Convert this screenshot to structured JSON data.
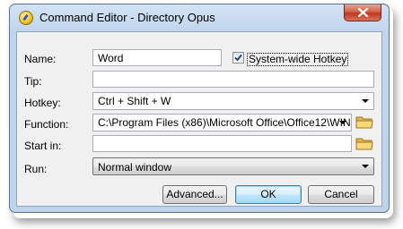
{
  "window": {
    "title": "Command Editor - Directory Opus"
  },
  "form": {
    "name_label": "Name:",
    "name_value": "Word",
    "system_hotkey_label": "System-wide Hotkey",
    "system_hotkey_checked": true,
    "tip_label": "Tip:",
    "tip_value": "",
    "hotkey_label": "Hotkey:",
    "hotkey_value": "Ctrl + Shift + W",
    "function_label": "Function:",
    "function_value": "C:\\Program Files (x86)\\Microsoft Office\\Office12\\WIN",
    "startin_label": "Start in:",
    "startin_value": "",
    "run_label": "Run:",
    "run_value": "Normal window"
  },
  "buttons": {
    "advanced": "Advanced...",
    "ok": "OK",
    "cancel": "Cancel"
  },
  "icons": {
    "app": "directory-opus-icon",
    "close": "close-icon",
    "folder": "folder-icon",
    "dropdown": "chevron-down-icon"
  }
}
